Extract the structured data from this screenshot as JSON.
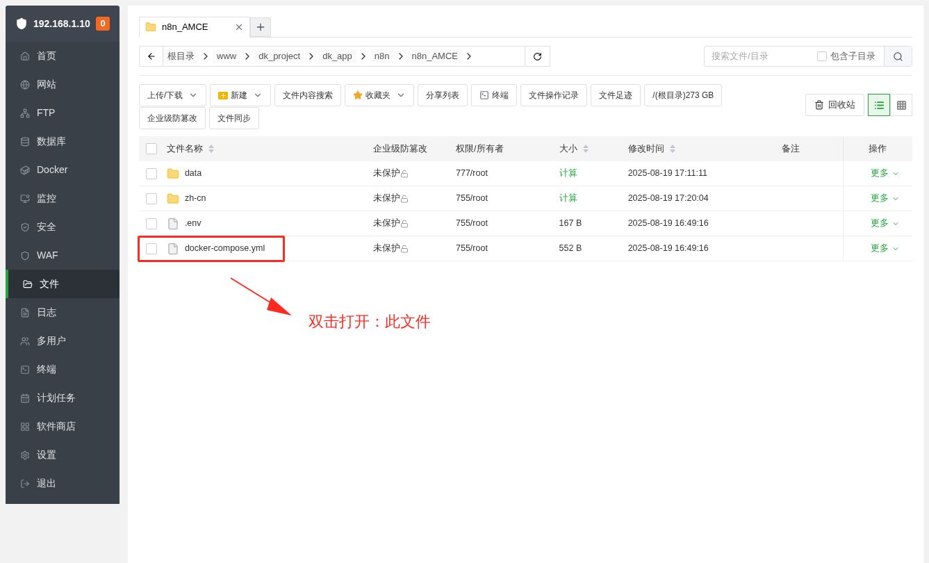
{
  "server": {
    "address": "192.168.1.10",
    "badge": "0"
  },
  "sidebar": {
    "items": [
      {
        "label": "首页",
        "selected": false
      },
      {
        "label": "网站",
        "selected": false
      },
      {
        "label": "FTP",
        "selected": false
      },
      {
        "label": "数据库",
        "selected": false
      },
      {
        "label": "Docker",
        "selected": false
      },
      {
        "label": "监控",
        "selected": false
      },
      {
        "label": "安全",
        "selected": false
      },
      {
        "label": "WAF",
        "selected": false
      },
      {
        "label": "文件",
        "selected": true
      },
      {
        "label": "日志",
        "selected": false
      },
      {
        "label": "多用户",
        "selected": false
      },
      {
        "label": "终端",
        "selected": false
      },
      {
        "label": "计划任务",
        "selected": false
      },
      {
        "label": "软件商店",
        "selected": false
      },
      {
        "label": "设置",
        "selected": false
      },
      {
        "label": "退出",
        "selected": false
      }
    ]
  },
  "tabs": [
    {
      "label": "n8n_AMCE",
      "selected": true
    }
  ],
  "breadcrumb": [
    "根目录",
    "www",
    "dk_project",
    "dk_app",
    "n8n",
    "n8n_AMCE"
  ],
  "search": {
    "placeholder": "搜索文件/目录",
    "include_subdirs": {
      "label": "包含子目录",
      "checked": false
    }
  },
  "toolbar": [
    {
      "label": "上传/下载",
      "kind": "dropdown"
    },
    {
      "label": "新建",
      "kind": "new"
    },
    {
      "label": "文件内容搜索",
      "kind": "plain"
    },
    {
      "label": "收藏夹",
      "kind": "favorites"
    },
    {
      "label": "分享列表",
      "kind": "plain"
    },
    {
      "label": "终端",
      "kind": "terminal"
    },
    {
      "label": "文件操作记录",
      "kind": "plain"
    },
    {
      "label": "文件足迹",
      "kind": "plain"
    },
    {
      "label": "/(根目录)273 GB",
      "kind": "plain"
    },
    {
      "label": "企业级防篡改",
      "kind": "plain"
    },
    {
      "label": "文件同步",
      "kind": "plain"
    }
  ],
  "recycle_bin": "回收站",
  "view_modes": [
    {
      "kind": "list",
      "selected": true
    },
    {
      "kind": "grid",
      "selected": false
    }
  ],
  "table": {
    "all_checked": false,
    "columns": [
      {
        "label": "文件名称",
        "sortable": true
      },
      {
        "label": "企业级防篡改",
        "sortable": false
      },
      {
        "label": "权限/所有者",
        "sortable": false
      },
      {
        "label": "大小",
        "sortable": true
      },
      {
        "label": "修改时间",
        "sortable": true
      },
      {
        "label": "备注",
        "sortable": false
      },
      {
        "label": "操作",
        "sortable": false
      }
    ],
    "rows": [
      {
        "kind": "folder",
        "name": "data",
        "protection": "未保护",
        "permission": "777/root",
        "size": "计算",
        "size_clickable": true,
        "modified": "2025-08-19 17:11:11",
        "action": "更多",
        "highlighted": false,
        "checked": false
      },
      {
        "kind": "folder",
        "name": "zh-cn",
        "protection": "未保护",
        "permission": "755/root",
        "size": "计算",
        "size_clickable": true,
        "modified": "2025-08-19 17:20:04",
        "action": "更多",
        "highlighted": false,
        "checked": false
      },
      {
        "kind": "file",
        "name": ".env",
        "protection": "未保护",
        "permission": "755/root",
        "size": "167 B",
        "size_clickable": false,
        "modified": "2025-08-19 16:49:16",
        "action": "更多",
        "highlighted": false,
        "checked": false
      },
      {
        "kind": "file",
        "name": "docker-compose.yml",
        "protection": "未保护",
        "permission": "755/root",
        "size": "552 B",
        "size_clickable": false,
        "modified": "2025-08-19 16:49:16",
        "action": "更多",
        "highlighted": true,
        "checked": false
      }
    ]
  },
  "annotation": {
    "text": "双击打开：此文件"
  }
}
